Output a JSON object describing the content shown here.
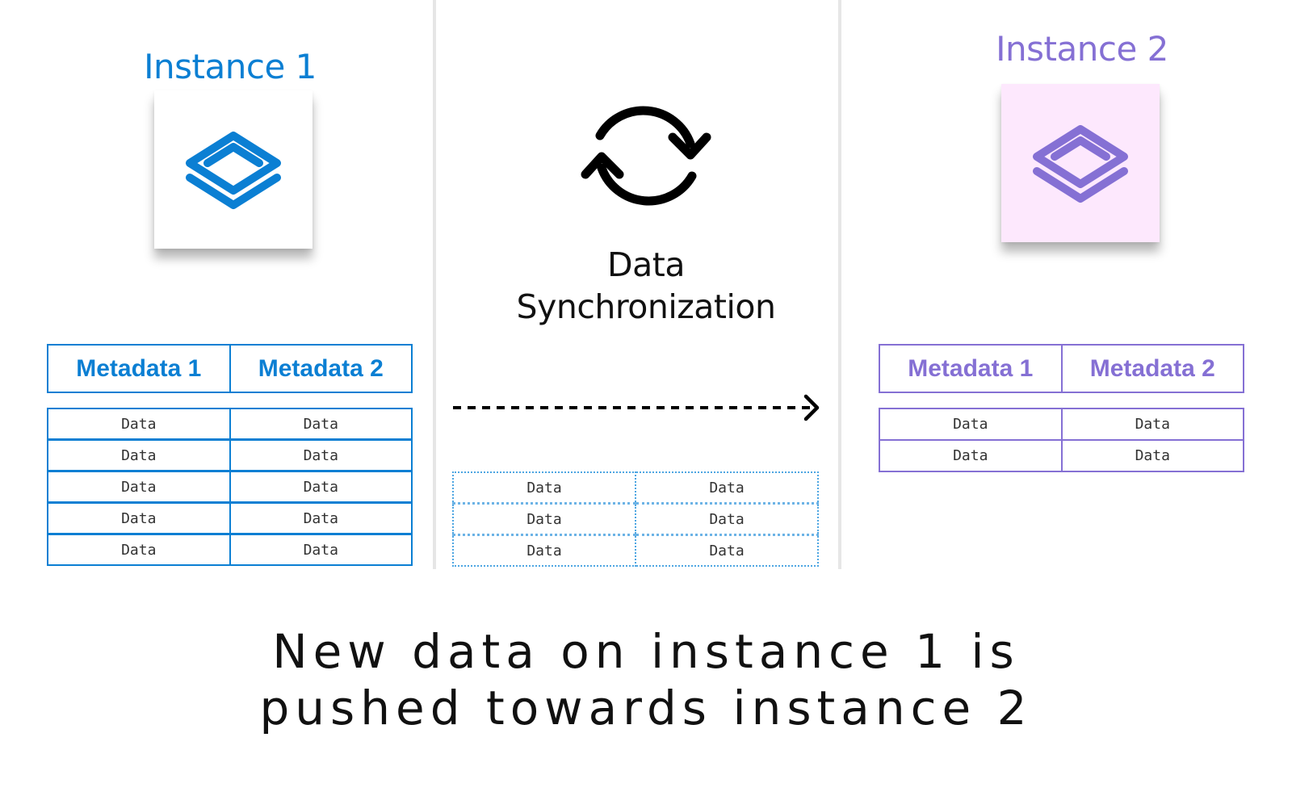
{
  "instance1": {
    "title": "Instance 1",
    "icon": "layers-icon",
    "accent_color": "#0b7fd3",
    "columns": [
      "Metadata 1",
      "Metadata 2"
    ],
    "rows": [
      [
        "Data",
        "Data"
      ],
      [
        "Data",
        "Data"
      ],
      [
        "Data",
        "Data"
      ],
      [
        "Data",
        "Data"
      ],
      [
        "Data",
        "Data"
      ]
    ]
  },
  "sync": {
    "icon": "sync-arrows-icon",
    "label_line1": "Data",
    "label_line2": "Synchronization",
    "arrow": "dashed-arrow-right-icon",
    "pending_rows": [
      [
        "Data",
        "Data"
      ],
      [
        "Data",
        "Data"
      ],
      [
        "Data",
        "Data"
      ]
    ]
  },
  "instance2": {
    "title": "Instance 2",
    "icon": "layers-icon",
    "accent_color": "#8570d4",
    "card_color": "#fde8fd",
    "columns": [
      "Metadata 1",
      "Metadata 2"
    ],
    "rows": [
      [
        "Data",
        "Data"
      ],
      [
        "Data",
        "Data"
      ]
    ]
  },
  "caption": {
    "line1": "New data on instance 1 is",
    "line2": "pushed towards instance 2"
  }
}
